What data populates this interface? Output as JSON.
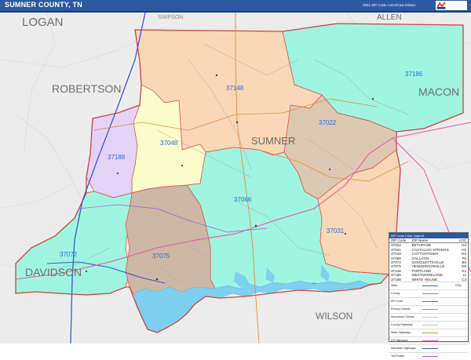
{
  "header": {
    "title": "SUMNER COUNTY, TN",
    "edition": "2022 ZIP Code Color/Cast Edition"
  },
  "neighbors": [
    {
      "name": "LOGAN"
    },
    {
      "name": "SIMPSON"
    },
    {
      "name": "ALLEN"
    },
    {
      "name": "ROBERTSON"
    },
    {
      "name": "MACON"
    },
    {
      "name": "DAVIDSON"
    },
    {
      "name": "WILSON"
    }
  ],
  "county_name": "SUMNER",
  "zip_labels": [
    "37186",
    "37148",
    "37022",
    "37048",
    "37188",
    "37066",
    "37031",
    "37072",
    "37075"
  ],
  "legend": {
    "header": "ZIP Code Color Legend",
    "columns": [
      "ZIP Code",
      "ZIP Name",
      "LOC"
    ],
    "rows": [
      {
        "zip": "37022",
        "name": "BETHPAGE",
        "loc": "H3"
      },
      {
        "zip": "37031",
        "name": "CASTALIAN SPRINGS",
        "loc": "H5"
      },
      {
        "zip": "37048",
        "name": "COTTONTOWN",
        "loc": "D3"
      },
      {
        "zip": "37066",
        "name": "GALLATIN",
        "loc": "F5"
      },
      {
        "zip": "37072",
        "name": "GOODLETTSVILLE",
        "loc": "B6"
      },
      {
        "zip": "37075",
        "name": "HENDERSONVILLE",
        "loc": "D6"
      },
      {
        "zip": "37148",
        "name": "PORTLAND",
        "loc": "E2"
      },
      {
        "zip": "37186",
        "name": "WESTMORELAND",
        "loc": "I2"
      },
      {
        "zip": "37188",
        "name": "WHITE HOUSE",
        "loc": "C3"
      }
    ],
    "key": [
      {
        "label": "State",
        "symbol": "city-icon",
        "extra": "City",
        "color": "#2a6fdb"
      },
      {
        "label": "County",
        "desc": "",
        "color": "#8a8a8a"
      },
      {
        "label": "ZIP Code",
        "desc": "",
        "color": "#d94a4a"
      },
      {
        "label": "Primary Streets",
        "desc": "",
        "color": "#9a9a9a"
      },
      {
        "label": "Secondary Streets",
        "desc": "",
        "color": "#c8c8c8"
      },
      {
        "label": "County Highways",
        "desc": "",
        "color": "#b7b7b7"
      },
      {
        "label": "State Highways",
        "desc": "",
        "color": "#e88c3a"
      },
      {
        "label": "US Highways",
        "desc": "",
        "color": "#e85aa8"
      },
      {
        "label": "Interstate Highways",
        "desc": "",
        "color": "#3a56d8"
      },
      {
        "label": "Toll Roads",
        "desc": "",
        "color": "#d64ad6"
      }
    ]
  },
  "colors": {
    "zip_37186": "#9ff5df",
    "zip_37148": "#fad7b6",
    "zip_37022": "#dcc8b2",
    "zip_37048": "#fdfccb",
    "zip_37188": "#e5d2f7",
    "zip_37066": "#9ff5df",
    "zip_37031": "#fad7b6",
    "zip_37072": "#9ff5df",
    "zip_37075": "#cdb7a5",
    "water": "#7ecff0",
    "outside": "#ececec",
    "county_border": "#cc4444",
    "interstate": "#3a56d8",
    "us_highway": "#e85aa8",
    "state_highway": "#e88c3a",
    "header_bg": "#2c5aa0"
  }
}
